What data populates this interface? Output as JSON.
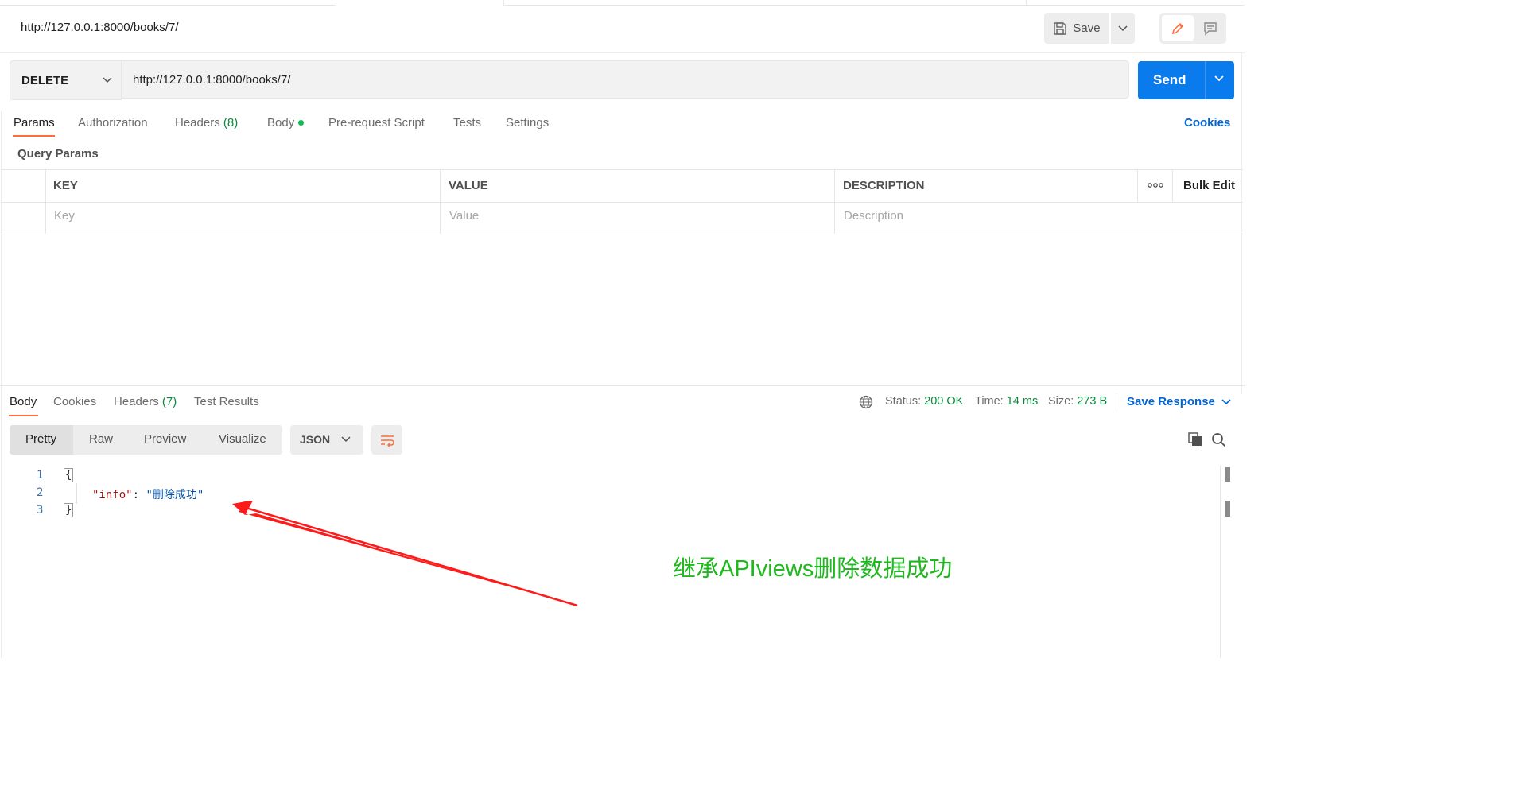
{
  "header": {
    "request_title": "http://127.0.0.1:8000/books/7/",
    "save_label": "Save"
  },
  "request": {
    "method": "DELETE",
    "url": "http://127.0.0.1:8000/books/7/",
    "send_label": "Send"
  },
  "request_tabs": {
    "params": "Params",
    "authorization": "Authorization",
    "headers": "Headers",
    "headers_count": "(8)",
    "body": "Body",
    "prerequest": "Pre-request Script",
    "tests": "Tests",
    "settings": "Settings",
    "cookies": "Cookies"
  },
  "query_params": {
    "title": "Query Params",
    "columns": {
      "key": "KEY",
      "value": "VALUE",
      "description": "DESCRIPTION"
    },
    "bulk_edit": "Bulk Edit",
    "placeholders": {
      "key": "Key",
      "value": "Value",
      "description": "Description"
    }
  },
  "response_tabs": {
    "body": "Body",
    "cookies": "Cookies",
    "headers": "Headers",
    "headers_count": "(7)",
    "test_results": "Test Results"
  },
  "response_status": {
    "status_label": "Status:",
    "status_value": "200 OK",
    "time_label": "Time:",
    "time_value": "14 ms",
    "size_label": "Size:",
    "size_value": "273 B",
    "save_response": "Save Response"
  },
  "body_view": {
    "options": [
      "Pretty",
      "Raw",
      "Preview",
      "Visualize"
    ],
    "active": "Pretty",
    "format": "JSON"
  },
  "response_body": {
    "line_numbers": [
      "1",
      "2",
      "3"
    ],
    "open_brace": "{",
    "key": "\"info\"",
    "colon": ": ",
    "value": "\"删除成功\"",
    "close_brace": "}"
  },
  "annotation": {
    "text": "继承APIviews删除数据成功",
    "text_color": "#1fb91f",
    "arrow_color": "#ff1a1a"
  },
  "colors": {
    "accent_blue": "#097bed",
    "tab_underline": "#ff6c37",
    "status_green": "#0b8a3e",
    "link_blue": "#0265d2"
  },
  "icons": [
    "save-icon",
    "chevron-down-icon",
    "pencil-icon",
    "comment-icon",
    "more-horizontal-icon",
    "globe-icon",
    "wrap-lines-icon",
    "copy-icon",
    "search-icon"
  ]
}
